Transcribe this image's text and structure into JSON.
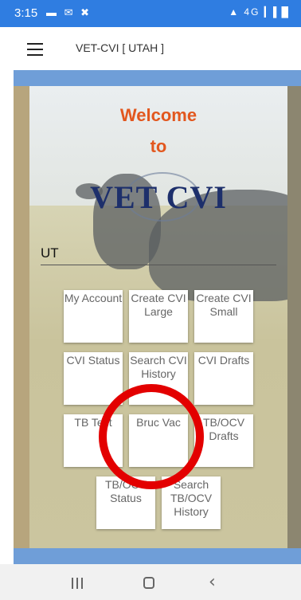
{
  "status_bar": {
    "time": "3:15",
    "left_icons": "▬ ✉ ✖",
    "right_icons": "▲ 4G ▎▌█"
  },
  "app_bar": {
    "title": "VET-CVI [ UTAH ]"
  },
  "welcome": {
    "line1": "Welcome",
    "line2": "to",
    "logo": "VET CVI"
  },
  "state_field": {
    "value": "UT"
  },
  "tiles": {
    "my_account": "My Account",
    "create_cvi_large": "Create CVI Large",
    "create_cvi_small": "Create CVI Small",
    "cvi_status": "CVI Status",
    "search_cvi_history": "Search CVI History",
    "cvi_drafts": "CVI Drafts",
    "tb_test": "TB Test",
    "bruc_vac": "Bruc Vac",
    "tb_ocv_drafts": "TB/OCV Drafts",
    "tb_ocv_status": "TB/OCV Status",
    "search_tb_ocv_history": "Search TB/OCV History"
  },
  "colors": {
    "status_bar": "#2f7de1",
    "welcome_text": "#e2571e",
    "logo_text": "#1d2f6b",
    "band": "#6f9ed8",
    "highlight_circle": "#e30000"
  },
  "nav_bar": {
    "back_glyph": "‹"
  }
}
